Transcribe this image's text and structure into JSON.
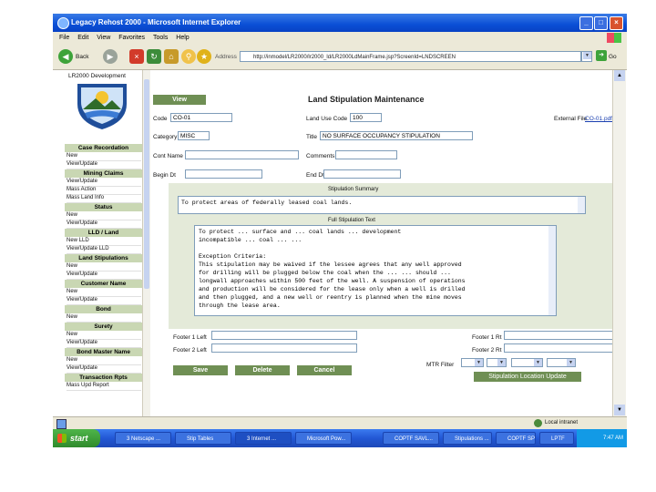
{
  "window": {
    "title": "Legacy Rehost 2000 - Microsoft Internet Explorer"
  },
  "menu": [
    "File",
    "Edit",
    "View",
    "Favorites",
    "Tools",
    "Help"
  ],
  "toolbar": {
    "back_label": "Back",
    "address_label": "Address",
    "address_value": "http://inmodel/LR2000/lr2000_ld/LR2000LdMainFrame.jsp?ScreenId=LNDSCREEN",
    "go_label": "Go"
  },
  "sidebar": {
    "header": "LR2000 Development",
    "sections": [
      {
        "title": "Case Recordation",
        "items": [
          "New",
          "View/Update"
        ]
      },
      {
        "title": "Mining Claims",
        "items": [
          "View/Update",
          "Mass Action",
          "Mass Land Info"
        ]
      },
      {
        "title": "Status",
        "items": [
          "New",
          "View/Update"
        ]
      },
      {
        "title": "LLD / Land",
        "items": [
          "New LLD",
          "View/Update LLD"
        ]
      },
      {
        "title": "Land Stipulations",
        "items": [
          "New",
          "View/Update"
        ]
      },
      {
        "title": "Customer Name",
        "items": [
          "New",
          "View/Update"
        ]
      },
      {
        "title": "Bond",
        "items": [
          "New"
        ]
      },
      {
        "title": "Surety",
        "items": [
          "New",
          "View/Update"
        ]
      },
      {
        "title": "Bond Master Name",
        "items": [
          "New",
          "View/Update"
        ]
      },
      {
        "title": "Transaction Rpts",
        "items": [
          "Mass Upd Report"
        ]
      }
    ]
  },
  "form": {
    "view_button": "View",
    "page_title": "Land Stipulation Maintenance",
    "code_label": "Code",
    "code_value": "CO-01",
    "land_use_code_label": "Land Use Code",
    "land_use_code_value": "100",
    "external_file_label": "External File",
    "external_file_value": "CO-01.pdf",
    "category_label": "Category",
    "category_value": "MISC",
    "title_label": "Title",
    "title_value": "NO SURFACE OCCUPANCY STIPULATION",
    "cont_name_label": "Cont Name",
    "cont_name_value": "",
    "comments_label": "Comments",
    "comments_value": "",
    "begin_dt_label": "Begin Dt",
    "begin_dt_value": "",
    "end_dt_label": "End Dt",
    "end_dt_value": "",
    "summary_label": "Stipulation Summary",
    "summary_text": "To protect areas of federally leased coal lands.",
    "full_text_label": "Full Stipulation Text",
    "full_text_lines": [
      "To protect ... surface and ... coal lands ... development",
      "  incompatible ... coal ... ...",
      "",
      "Exception Criteria:",
      "This stipulation may be waived if the lessee agrees that any well approved",
      "for drilling will be plugged below the coal when the ... ... should ...",
      "longwall approaches within 500 feet of the well.  A suspension of operations",
      "and production will be considered for the lease only when a well is drilled",
      "and then plugged, and a new well or reentry is planned when the mine moves",
      "through the lease area."
    ],
    "footer_1_left_label": "Footer 1 Left",
    "footer_1_right_label": "Footer 1 Rt",
    "footer_2_left_label": "Footer 2 Left",
    "footer_2_right_label": "Footer 2 Rt",
    "mtr_filter_label": "MTR Filter",
    "save_button": "Save",
    "delete_button": "Delete",
    "cancel_button": "Cancel",
    "stip_location_button": "Stipulation Location Update"
  },
  "statusbar": {
    "zone": "Local intranet"
  },
  "taskbar": {
    "start": "start",
    "tasks": [
      "3 Netscape ...",
      "Stip Tables",
      "3 Internet ...",
      "Microsoft Pow...",
      "COPTF SAVL...",
      "Stipulations ...",
      "COPTF SPR...",
      "LPTF"
    ],
    "clock": "7:47 AM"
  }
}
